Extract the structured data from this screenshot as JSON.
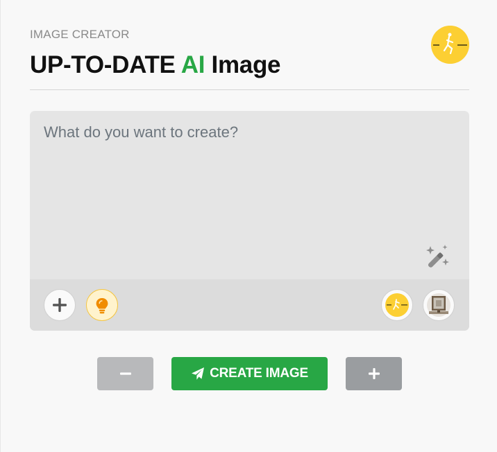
{
  "header": {
    "overline": "IMAGE CREATOR",
    "title_part1": "UP-TO-DATE ",
    "title_accent": "AI",
    "title_part2": " Image"
  },
  "prompt": {
    "placeholder": "What do you want to create?",
    "value": ""
  },
  "toolbar": {
    "add_icon": "plus-icon",
    "idea_icon": "lightbulb-icon",
    "wand_icon": "magic-wand-icon",
    "style_thumb": "style-thumbnail",
    "frame_thumb": "frame-thumbnail"
  },
  "actions": {
    "create_label": "CREATE IMAGE",
    "create_icon": "paper-plane-icon",
    "decrease_icon": "minus-icon",
    "increase_icon": "plus-icon"
  },
  "colors": {
    "accent": "#28a745",
    "logo_yellow": "#fccf33",
    "idea_orange": "#f08c00"
  }
}
